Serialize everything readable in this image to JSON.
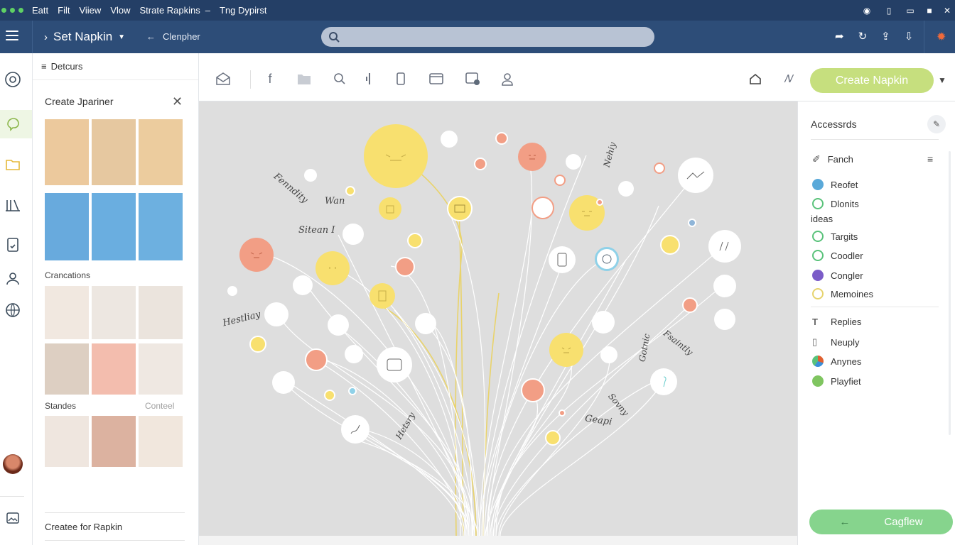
{
  "menubar": {
    "items": [
      "Eatt",
      "Filt",
      "Viiew",
      "Vlow",
      "Strate Rapkins",
      "Tng Dypirst"
    ]
  },
  "appbar": {
    "project": "Set Napkin",
    "crumb": "Clenpher"
  },
  "sidebar": {
    "header": "Detcurs",
    "panel_title": "Create Jpariner",
    "section1": "Crancations",
    "section2": "Standes",
    "section2_right": "Conteel",
    "bottom_link": "Createe for Rapkin",
    "swatches_top": [
      "#ecc99d",
      "#e6c8a0",
      "#eccc9e"
    ],
    "swatches_blue": [
      "#68aadd",
      "#6aaee0",
      "#6db0e0"
    ],
    "swatches_mid1": [
      "#f1e8e0",
      "#ede7e1",
      "#ebe4dd"
    ],
    "swatches_mid2": [
      "#ddcfc2",
      "#f3bdae",
      "#efe8e2"
    ],
    "swatches_bot": [
      "#efe6df",
      "#dcb2a0",
      "#f1e7dd"
    ]
  },
  "toolbar": {
    "create_label": "Create Napkin"
  },
  "canvas": {
    "labels": [
      "Fenndity",
      "Wan",
      "Sitean I",
      "Hestliay",
      "Hetsry",
      "Fsaintly",
      "Sovny",
      "Geapi",
      "Nehiy",
      "Gotnic"
    ],
    "colors": {
      "yellow": "#f7e06b",
      "orange": "#f0a081",
      "white": "#ffffff"
    }
  },
  "right_panel": {
    "title": "Accessrds",
    "items": [
      {
        "label": "Fanch",
        "color": "#555"
      },
      {
        "label": "Reofet",
        "color": "#5aa9d9"
      },
      {
        "label": "Dlonits",
        "color": "#59c27a"
      },
      {
        "label": "ideas",
        "color": ""
      },
      {
        "label": "Targits",
        "color": "#59c27a"
      },
      {
        "label": "Coodler",
        "color": "#59c27a"
      },
      {
        "label": "Congler",
        "color": "#7b5cc8"
      },
      {
        "label": "Memoines",
        "color": "#e6d36d"
      },
      {
        "label": "Replies",
        "color": "#666"
      },
      {
        "label": "Neuply",
        "color": "#666"
      },
      {
        "label": "Anynes",
        "color": "#e06030"
      },
      {
        "label": "Playfiet",
        "color": "#7fc560"
      }
    ],
    "bottom_button": "Cagflew"
  }
}
